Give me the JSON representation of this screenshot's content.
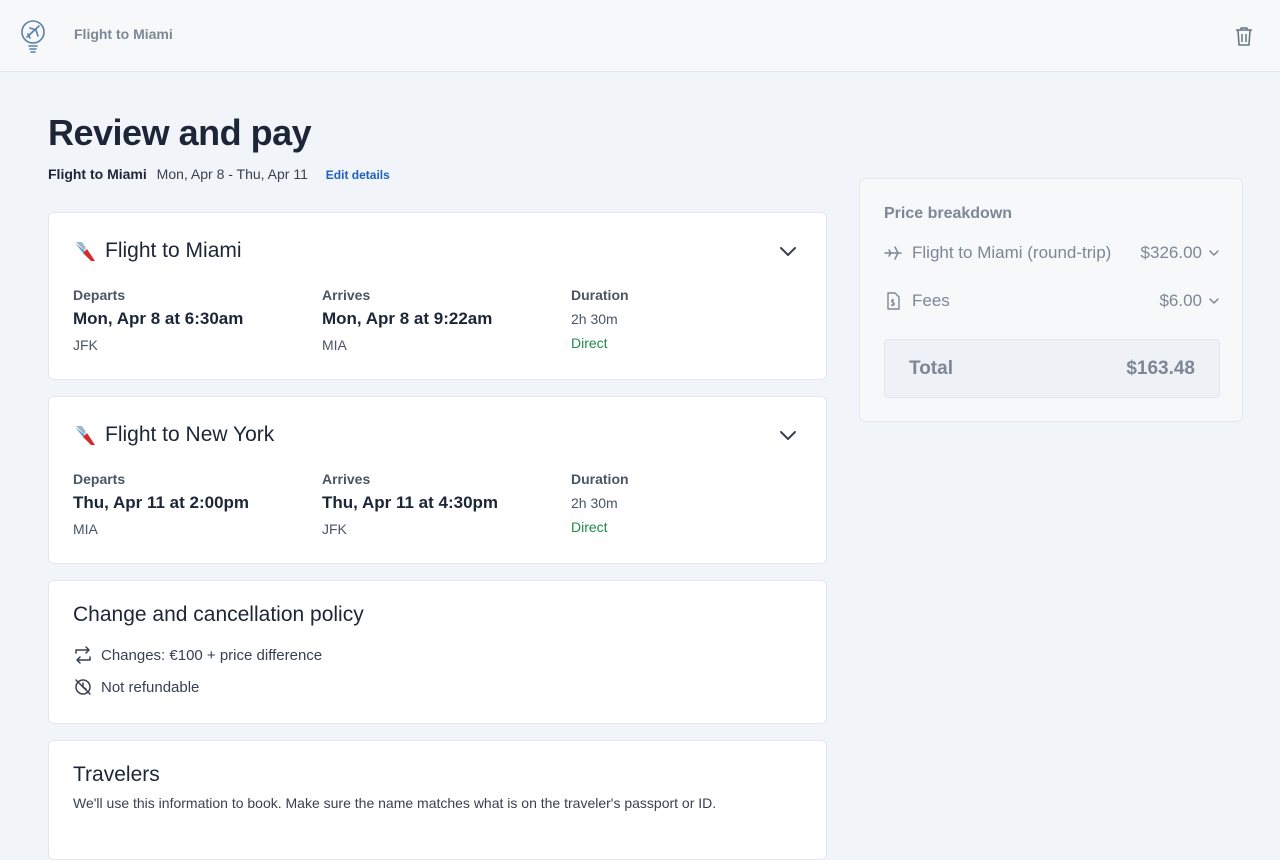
{
  "header": {
    "title": "Flight to Miami",
    "logo_icon": "plane-bulb-icon",
    "delete_icon": "trash-icon"
  },
  "page": {
    "title": "Review and pay",
    "trip_name": "Flight to Miami",
    "dates": "Mon, Apr 8 - Thu, Apr 11",
    "edit_label": "Edit details"
  },
  "flights": [
    {
      "title": "Flight to Miami",
      "departs_label": "Departs",
      "departs_time": "Mon, Apr 8 at 6:30am",
      "departs_airport": "JFK",
      "arrives_label": "Arrives",
      "arrives_time": "Mon, Apr 8 at 9:22am",
      "arrives_airport": "MIA",
      "duration_label": "Duration",
      "duration": "2h 30m",
      "stops": "Direct"
    },
    {
      "title": "Flight to New York",
      "departs_label": "Departs",
      "departs_time": "Thu, Apr 11 at 2:00pm",
      "departs_airport": "MIA",
      "arrives_label": "Arrives",
      "arrives_time": "Thu, Apr 11 at 4:30pm",
      "arrives_airport": "JFK",
      "duration_label": "Duration",
      "duration": "2h 30m",
      "stops": "Direct"
    }
  ],
  "policy": {
    "title": "Change and cancellation policy",
    "changes": "Changes: €100 + price difference",
    "refund": "Not refundable"
  },
  "travelers": {
    "title": "Travelers",
    "description": "We'll use this information to book. Make sure the name matches what is on the traveler's passport or ID."
  },
  "price_breakdown": {
    "title": "Price breakdown",
    "items": [
      {
        "label": "Flight to Miami (round-trip)",
        "amount": "$326.00",
        "icon": "plane-icon"
      },
      {
        "label": "Fees",
        "amount": "$6.00",
        "icon": "receipt-icon"
      }
    ],
    "total_label": "Total",
    "total_amount": "$163.48"
  },
  "colors": {
    "accent": "#1f5fbf",
    "direct": "#1f8a4c",
    "muted": "#7d8795"
  }
}
